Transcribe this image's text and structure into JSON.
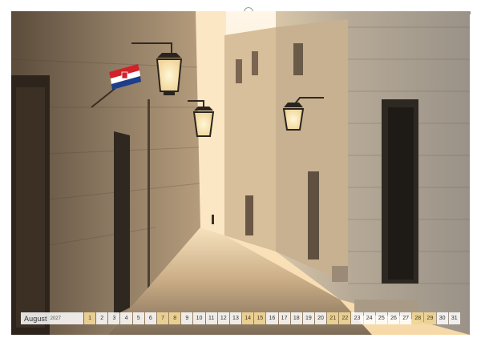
{
  "calendar": {
    "month": "August",
    "year": "2027",
    "days": [
      {
        "n": "1",
        "weekend": true
      },
      {
        "n": "2",
        "weekend": false
      },
      {
        "n": "3",
        "weekend": false
      },
      {
        "n": "4",
        "weekend": false
      },
      {
        "n": "5",
        "weekend": false
      },
      {
        "n": "6",
        "weekend": false
      },
      {
        "n": "7",
        "weekend": true
      },
      {
        "n": "8",
        "weekend": true
      },
      {
        "n": "9",
        "weekend": false
      },
      {
        "n": "10",
        "weekend": false
      },
      {
        "n": "11",
        "weekend": false
      },
      {
        "n": "12",
        "weekend": false
      },
      {
        "n": "13",
        "weekend": false
      },
      {
        "n": "14",
        "weekend": true
      },
      {
        "n": "15",
        "weekend": true
      },
      {
        "n": "16",
        "weekend": false
      },
      {
        "n": "17",
        "weekend": false
      },
      {
        "n": "18",
        "weekend": false
      },
      {
        "n": "19",
        "weekend": false
      },
      {
        "n": "20",
        "weekend": false
      },
      {
        "n": "21",
        "weekend": true
      },
      {
        "n": "22",
        "weekend": true
      },
      {
        "n": "23",
        "weekend": false
      },
      {
        "n": "24",
        "weekend": false
      },
      {
        "n": "25",
        "weekend": false
      },
      {
        "n": "26",
        "weekend": false
      },
      {
        "n": "27",
        "weekend": false
      },
      {
        "n": "28",
        "weekend": true
      },
      {
        "n": "29",
        "weekend": true
      },
      {
        "n": "30",
        "weekend": false
      },
      {
        "n": "31",
        "weekend": false
      }
    ],
    "weekend_color": "#f1d696"
  },
  "photo": {
    "subject": "narrow stone alley with hanging lanterns",
    "flag_colors": [
      "#d3202a",
      "#ffffff",
      "#1d3e8a"
    ]
  }
}
